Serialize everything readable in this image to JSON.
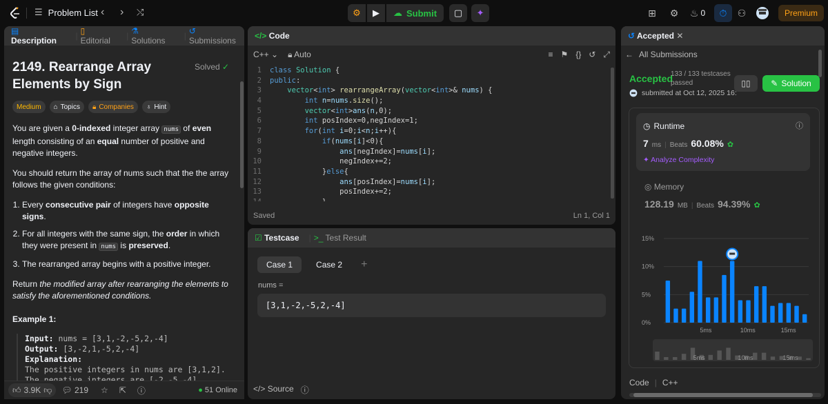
{
  "topbar": {
    "problem_list": "Problem List",
    "submit": "Submit",
    "streak": "0",
    "premium": "Premium"
  },
  "left": {
    "tabs": [
      "Description",
      "Editorial",
      "Solutions",
      "Submissions"
    ],
    "title": "2149. Rearrange Array Elements by Sign",
    "solved": "Solved",
    "chips": [
      "Medium",
      "Topics",
      "Companies",
      "Hint"
    ],
    "example_title": "Example 1:",
    "example": {
      "input_label": "Input:",
      "input": "nums = [3,1,-2,-5,2,-4]",
      "output_label": "Output:",
      "output": "[3,-2,1,-5,2,-4]",
      "explanation_label": "Explanation:",
      "explanation": "The positive integers in nums are [3,1,2].",
      "explanation2": "The negative integers are [-2,-5,-4]."
    },
    "footer": {
      "likes": "3.9K",
      "comments": "219",
      "online": "51 Online"
    }
  },
  "code": {
    "title": "Code",
    "language": "C++",
    "mode": "Auto",
    "status": "Saved",
    "position": "Ln 1, Col 1",
    "lines": [
      "class Solution {",
      "public:",
      "    vector<int> rearrangeArray(vector<int>& nums) {",
      "        int n=nums.size();",
      "        vector<int>ans(n,0);",
      "        int posIndex=0,negIndex=1;",
      "        for(int i=0;i<n;i++){",
      "            if(nums[i]<0){",
      "                ans[negIndex]=nums[i];",
      "                negIndex+=2;",
      "            }else{",
      "                ans[posIndex]=nums[i];",
      "                posIndex+=2;",
      "            }"
    ]
  },
  "testcase": {
    "tabs": [
      "Testcase",
      "Test Result"
    ],
    "cases": [
      "Case 1",
      "Case 2"
    ],
    "label": "nums =",
    "value": "[3,1,-2,-5,2,-4]",
    "source": "Source"
  },
  "right": {
    "tab": "Accepted",
    "all_submissions": "All Submissions",
    "status": "Accepted",
    "passed": "133 / 133 testcases passed",
    "solution_btn": "Solution",
    "submitted": "submitted at Oct 12, 2025 16:",
    "runtime": {
      "title": "Runtime",
      "value": "7",
      "unit": "ms",
      "beats_label": "Beats",
      "beats": "60.08%",
      "analyze": "Analyze Complexity"
    },
    "memory": {
      "title": "Memory",
      "value": "128.19",
      "unit": "MB",
      "beats_label": "Beats",
      "beats": "94.39%"
    },
    "footer": [
      "Code",
      "C++"
    ],
    "accent_green": "#28c244",
    "bar_blue": "#0a84ff"
  },
  "chart_data": {
    "type": "bar",
    "yticks": [
      "15%",
      "10%",
      "5%",
      "0%"
    ],
    "ylim": [
      0,
      15
    ],
    "xticks": [
      "5ms",
      "10ms",
      "15ms"
    ],
    "values": [
      7.5,
      2.5,
      2.5,
      5.5,
      11,
      4.5,
      4.5,
      8.5,
      11,
      4,
      4,
      6.5,
      6.5,
      3,
      3.5,
      3.5,
      3,
      1.5
    ],
    "highlight_index": 8,
    "grid": true
  }
}
